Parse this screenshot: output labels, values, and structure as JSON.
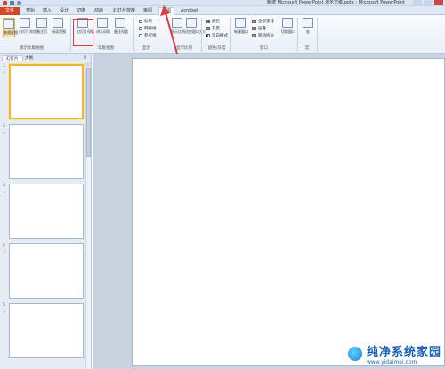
{
  "title_bar": {
    "text": "新建 Microsoft PowerPoint 演示文稿.pptx - Microsoft PowerPoint"
  },
  "tabs": [
    {
      "label": "文件",
      "active": false
    },
    {
      "label": "开始",
      "active": false
    },
    {
      "label": "插入",
      "active": false
    },
    {
      "label": "设计",
      "active": false
    },
    {
      "label": "切换",
      "active": false
    },
    {
      "label": "动画",
      "active": false
    },
    {
      "label": "幻灯片放映",
      "active": false
    },
    {
      "label": "审阅",
      "active": false
    },
    {
      "label": "视图",
      "active": true
    },
    {
      "label": "Acrobat",
      "active": false
    }
  ],
  "ribbon": {
    "presentation_views": {
      "buttons": [
        "普通视图",
        "幻灯片浏览",
        "备注页",
        "阅读视图"
      ],
      "label": "演示文稿视图"
    },
    "master_views": {
      "buttons": [
        "幻灯片母版",
        "讲义母版",
        "备注母版"
      ],
      "label": "母版视图"
    },
    "show": {
      "checks": [
        "标尺",
        "网格线",
        "参考线"
      ],
      "label": "显示"
    },
    "zoom": {
      "buttons": [
        "显示比例",
        "适应窗口大小"
      ],
      "label": "显示比例"
    },
    "color": {
      "items": [
        "颜色",
        "灰度",
        "黑白模式"
      ],
      "label": "颜色/灰度"
    },
    "window": {
      "buttons": [
        "新建窗口"
      ],
      "items": [
        "全部重排",
        "层叠",
        "移动拆分"
      ],
      "switch": "切换窗口",
      "label": "窗口"
    },
    "macro": {
      "buttons": [
        "宏"
      ],
      "label": "宏"
    }
  },
  "panel": {
    "tabs": [
      "幻灯片",
      "大纲"
    ],
    "close": "×",
    "slides": [
      {
        "num": "1",
        "star": "☆"
      },
      {
        "num": "2",
        "star": "☆"
      },
      {
        "num": "3",
        "star": "☆"
      },
      {
        "num": "4",
        "star": "☆"
      },
      {
        "num": "5",
        "star": "☆"
      }
    ]
  },
  "watermark": {
    "main": "纯净系统家园",
    "sub": "www.yidaimei.com"
  }
}
